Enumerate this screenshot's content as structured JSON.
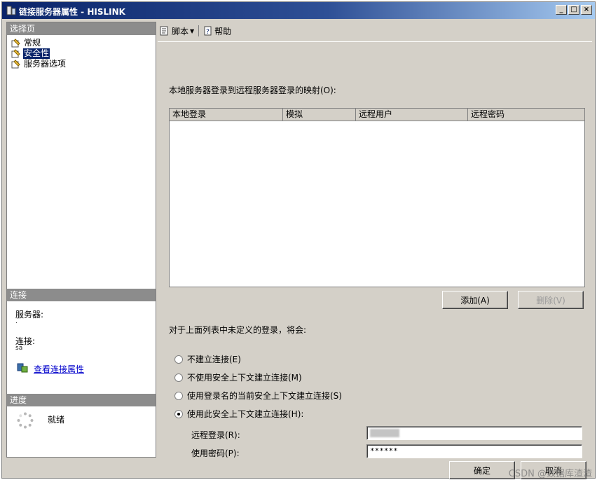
{
  "window": {
    "title": "链接服务器属性 - HISLINK",
    "controls": [
      "_",
      "□",
      "×"
    ]
  },
  "left": {
    "select_page_header": "选择页",
    "pages": [
      {
        "label": "常规",
        "icon": "page-icon"
      },
      {
        "label": "安全性",
        "icon": "page-icon",
        "selected": true
      },
      {
        "label": "服务器选项",
        "icon": "page-icon"
      }
    ],
    "connection_header": "连接",
    "server_label": "服务器:",
    "server_value": ".",
    "connection_label": "连接:",
    "connection_value": "sa",
    "view_link": "查看连接属性",
    "progress_header": "进度",
    "progress_status": "就绪"
  },
  "toolbar": {
    "script_label": "脚本",
    "help_label": "帮助"
  },
  "main": {
    "mapping_label": "本地服务器登录到远程服务器登录的映射(O):",
    "columns": [
      "本地登录",
      "模拟",
      "远程用户",
      "远程密码"
    ],
    "add_button": "添加(A)",
    "remove_button": "删除(V)",
    "undefined_login_label": "对于上面列表中未定义的登录，将会:",
    "options": [
      {
        "label": "不建立连接(E)",
        "checked": false
      },
      {
        "label": "不使用安全上下文建立连接(M)",
        "checked": false
      },
      {
        "label": "使用登录名的当前安全上下文建立连接(S)",
        "checked": false
      },
      {
        "label": "使用此安全上下文建立连接(H):",
        "checked": true
      }
    ],
    "remote_login_label": "远程登录(R):",
    "password_label": "使用密码(P):",
    "password_value": "******"
  },
  "footer": {
    "ok_button": "确定",
    "cancel_button": "取消",
    "watermark": "CSDN @数据库渣渣"
  },
  "colors": {
    "title_gradient_start": "#0a246a",
    "selection": "#0a246a",
    "section_header": "#8c8c8c",
    "link": "#0000cc"
  }
}
